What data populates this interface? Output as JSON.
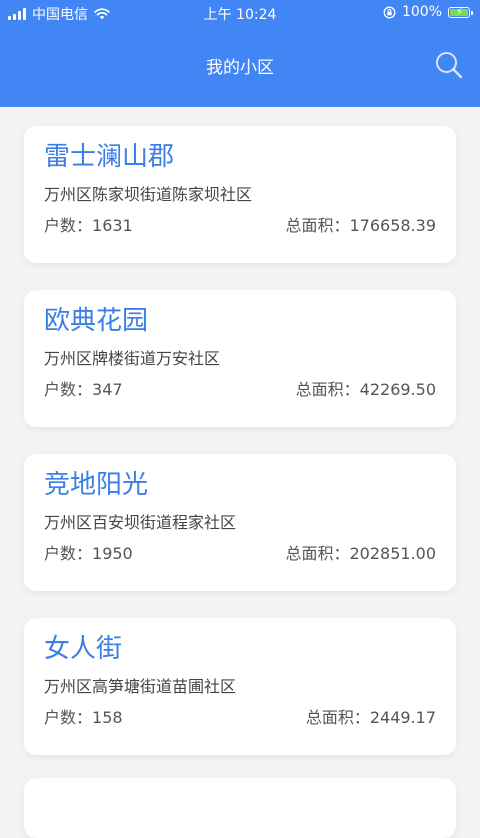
{
  "status_bar": {
    "carrier": "中国电信",
    "time": "上午 10:24",
    "battery_percent": "100%",
    "battery_color": "#7ed957"
  },
  "header": {
    "title": "我的小区",
    "background_color": "#4285f4",
    "search_icon": "search-icon"
  },
  "labels": {
    "households": "户数：",
    "total_area": "总面积："
  },
  "communities": [
    {
      "name": "雷士澜山郡",
      "address": "万州区陈家坝街道陈家坝社区",
      "households": "1631",
      "area": "176658.39"
    },
    {
      "name": "欧典花园",
      "address": "万州区牌楼街道万安社区",
      "households": "347",
      "area": "42269.50"
    },
    {
      "name": "竞地阳光",
      "address": "万州区百安坝街道程家社区",
      "households": "1950",
      "area": "202851.00"
    },
    {
      "name": "女人街",
      "address": "万州区高笋塘街道苗圃社区",
      "households": "158",
      "area": "2449.17"
    }
  ],
  "colors": {
    "accent": "#3b7ee8",
    "page_background": "#f4f4f6"
  }
}
